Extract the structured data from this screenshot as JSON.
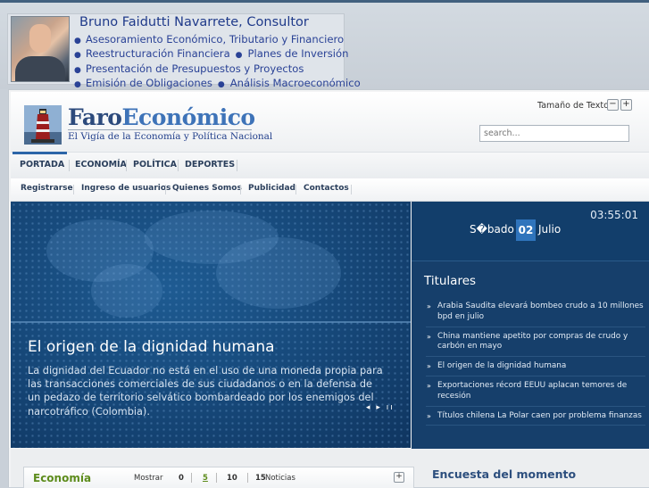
{
  "promo": {
    "name": "Bruno Faidutti Navarrete, Consultor",
    "services": [
      "Asesoramiento Económico, Tributario y Financiero",
      "Reestructuración Financiera",
      "Planes de Inversión",
      "Presentación de Presupuestos y Proyectos",
      "Emisión de Obligaciones",
      "Análisis Macroeconómico"
    ]
  },
  "header": {
    "brand_part1": "Faro",
    "brand_part2": "Económico",
    "tagline": "El Vigía de la Economía y Política Nacional",
    "text_size_label": "Tamaño de Texto",
    "minus": "−",
    "plus": "+",
    "search_placeholder": "search..."
  },
  "nav_primary": [
    "PORTADA",
    "ECONOMÍA",
    "POLÍTICA",
    "DEPORTES"
  ],
  "nav_secondary": [
    "Registrarse",
    "Ingreso de usuarios",
    "Quienes Somos",
    "Publicidad",
    "Contactos"
  ],
  "hero": {
    "title": "El origen de la dignidad humana",
    "body": "La dignidad del Ecuador no está en el uso de una moneda propia para las transacciones comerciales de sus ciudadanos o en la defensa de un pedazo de territorio selvático bombardeado por los enemigos del narcotráfico (Colombia).",
    "controls": "◂ ▸ ıı"
  },
  "sidebar": {
    "time": "03:55:01",
    "day": "S�bado",
    "date_num": "02",
    "month": "Julio",
    "titulares_heading": "Titulares",
    "titulares": [
      "Arabia Saudita elevará bombeo crudo a 10 millones bpd en julio",
      "China mantiene apetito por compras de crudo y carbón en mayo",
      "El origen de la dignidad humana",
      "Exportaciones récord EEUU aplacan temores de recesión",
      "Títulos chilena La Polar caen por problema finanzas"
    ]
  },
  "economia_panel": {
    "title": "Economía",
    "mostrar": "Mostrar",
    "options": [
      "0",
      "5",
      "10",
      "15"
    ],
    "selected": "5",
    "noticias": "Noticias",
    "expand": "+"
  },
  "encuesta": {
    "title": "Encuesta del momento"
  },
  "colors": {
    "brand_blue": "#2c4a7c",
    "nav_active": "#2c65a8",
    "econ_green": "#5d8c1c",
    "hero_bg": "#174a7c"
  }
}
